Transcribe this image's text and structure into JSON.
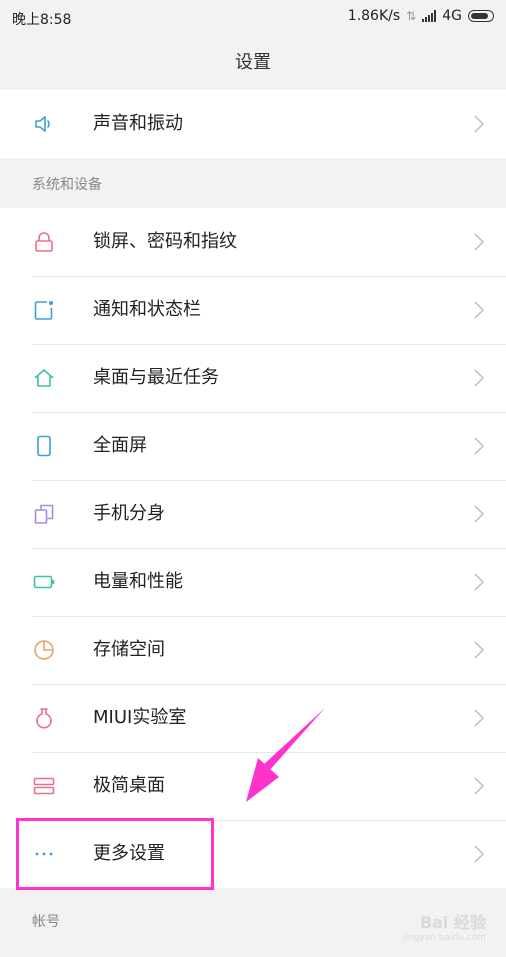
{
  "status_bar": {
    "time": "晚上8:58",
    "network_speed": "1.86K/s",
    "network_type": "4G",
    "icons": [
      "data-transfer-icon",
      "signal-icon",
      "battery-icon"
    ]
  },
  "header": {
    "title": "设置"
  },
  "top_items": [
    {
      "label": "声音和振动",
      "icon": "speaker-icon",
      "icon_color": "#3a9fd8"
    }
  ],
  "sections": [
    {
      "title": "系统和设备",
      "items": [
        {
          "label": "锁屏、密码和指纹",
          "icon": "lock-icon",
          "icon_color": "#e9708c"
        },
        {
          "label": "通知和状态栏",
          "icon": "notification-icon",
          "icon_color": "#3a9fd8"
        },
        {
          "label": "桌面与最近任务",
          "icon": "home-icon",
          "icon_color": "#3ec3a8"
        },
        {
          "label": "全面屏",
          "icon": "phone-icon",
          "icon_color": "#3a9fd8"
        },
        {
          "label": "手机分身",
          "icon": "dual-copy-icon",
          "icon_color": "#a88be0"
        },
        {
          "label": "电量和性能",
          "icon": "battery-outline-icon",
          "icon_color": "#3ec3a8"
        },
        {
          "label": "存储空间",
          "icon": "pie-chart-icon",
          "icon_color": "#f0a060"
        },
        {
          "label": "MIUI实验室",
          "icon": "flask-icon",
          "icon_color": "#e9708c"
        },
        {
          "label": "极简桌面",
          "icon": "simple-desktop-icon",
          "icon_color": "#e9708c"
        },
        {
          "label": "更多设置",
          "icon": "more-dots-icon",
          "icon_color": "#3a9fd8"
        }
      ]
    },
    {
      "title": "帐号",
      "items": []
    }
  ],
  "annotation": {
    "highlight_color": "#ff33cc",
    "highlighted_item": "更多设置"
  },
  "watermark": {
    "text": "Bai 经验",
    "subtext": "jingyan.baidu.com"
  }
}
